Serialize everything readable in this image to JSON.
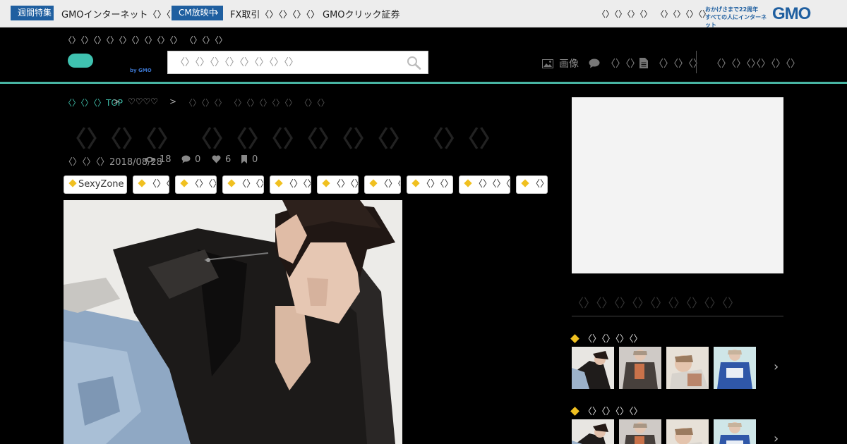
{
  "gmo_bar": {
    "badge1": "週間特集",
    "badge1_text": "GMOインターネット〈〉〈〉",
    "badge2": "CM放映中",
    "badge2_text": "FX取引〈〉〈〉〈〉〈〉 GMOクリック証券",
    "link1": "〈〉〈〉〈〉〈〉",
    "link2": "〈〉〈〉〈〉〈〉",
    "anniversary_line1": "おかげさまで22周年",
    "anniversary_line2": "すべての人にインターネット",
    "logo": "GMO",
    "brand_color": "#1f5fa0"
  },
  "header": {
    "tagline": "〈〉〈〉〈〉〈〉〈〉〈〉〈〉〈〉〈〉 〈〉〈〉〈〉",
    "logo_sub": "by GMO",
    "search_placeholder": "〈〉〈〉〈〉〈〉〈〉〈〉〈〉〈〉",
    "nav": [
      {
        "icon": "image-icon",
        "label": "画像"
      },
      {
        "icon": "comment-icon",
        "label": "〈〉〈〉"
      },
      {
        "icon": "document-icon",
        "label": "〈〉〈〉〈〉"
      },
      {
        "icon": "",
        "label": "〈〉〈〉〈〉"
      },
      {
        "icon": "",
        "label": "〈〉〈〉〈〉"
      }
    ],
    "accent_color": "#48b5a3"
  },
  "breadcrumb": {
    "home": "〈〉〈〉〈〉TOP",
    "sep": ">",
    "level2": "♡♡♡♡",
    "current": "〈〉〈〉〈〉 〈〉〈〉〈〉〈〉〈〉 〈〉〈〉"
  },
  "article": {
    "title": "〈〉〈〉〈〉 〈〉〈〉〈〉〈〉〈〉〈〉 〈〉〈〉",
    "date": "〈〉〈〉〈〉2018/08/28",
    "views": "18",
    "comments": "0",
    "likes": "6",
    "bookmarks": "0",
    "tags": [
      "SexyZone",
      "〈〉〈〉〈〉",
      "〈〉〈〉〈〉〈〉",
      "〈〉〈〉〈〉〈〉",
      "〈〉〈〉〈〉〈〉",
      "〈〉〈〉〈〉〈〉",
      "〈〉〈〉〈〉",
      "〈〉〈〉〈〉〈〉〈〉",
      "〈〉〈〉〈〉〈〉〈〉〈〉",
      "〈〉〈〉"
    ]
  },
  "sidebar": {
    "heading": "〈〉〈〉〈〉〈〉〈〉〈〉〈〉〈〉〈〉",
    "groups": [
      {
        "title": "〈〉〈〉〈〉〈〉"
      },
      {
        "title": "〈〉〈〉〈〉〈〉"
      }
    ],
    "next_arrow": "›"
  }
}
